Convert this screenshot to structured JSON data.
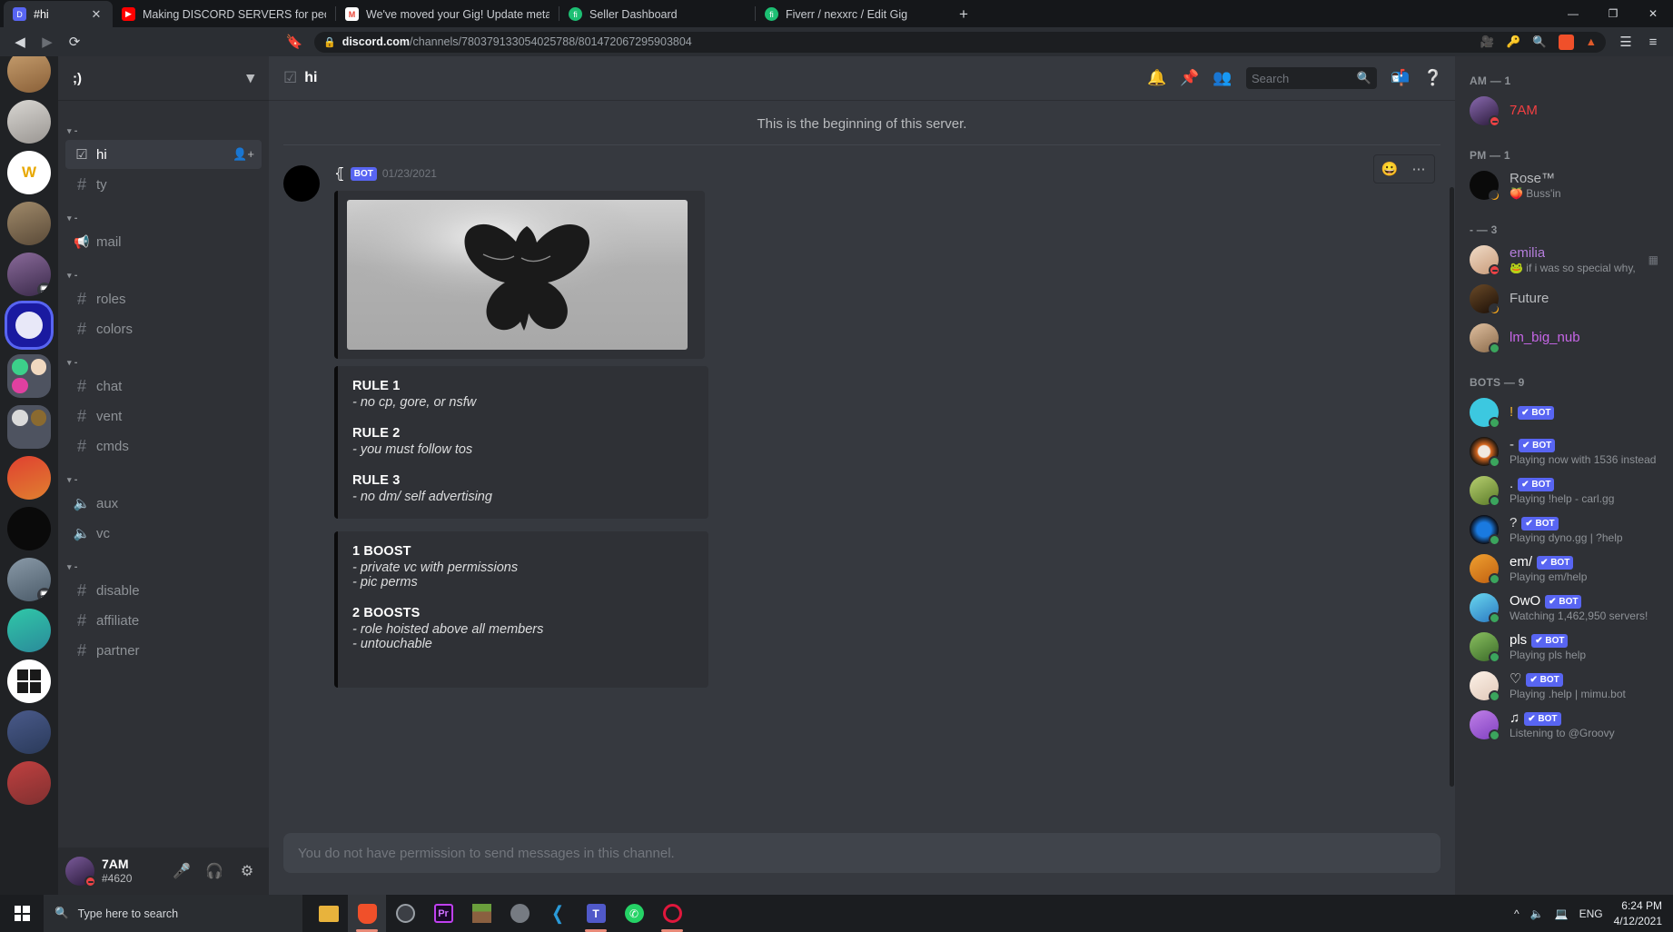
{
  "browser": {
    "tabs": [
      {
        "title": "#hi",
        "favicon": "discord-icon",
        "active": true
      },
      {
        "title": "Making DISCORD SERVERS for people",
        "favicon": "youtube-icon",
        "active": false
      },
      {
        "title": "We've moved your Gig! Update metad",
        "favicon": "gmail-icon",
        "active": false
      },
      {
        "title": "Seller Dashboard",
        "favicon": "fiverr-icon",
        "active": false
      },
      {
        "title": "Fiverr / nexxrc / Edit Gig",
        "favicon": "fiverr-icon",
        "active": false
      }
    ],
    "new_tab_label": "+",
    "window_controls": {
      "minimize": "—",
      "maximize": "❐",
      "close": "✕"
    },
    "url_host": "discord.com",
    "url_path": "/channels/780379133054025788/801472067295903804",
    "close_tab_label": "✕"
  },
  "guild_header": {
    "name": ";)",
    "chevron": "⌄"
  },
  "channels": {
    "categories": [
      {
        "name": "-",
        "items": [
          {
            "name": "hi",
            "type": "rules",
            "active": true,
            "invite": true
          },
          {
            "name": "ty",
            "type": "text",
            "active": false
          }
        ]
      },
      {
        "name": "-",
        "items": [
          {
            "name": "mail",
            "type": "announcement",
            "active": false
          }
        ]
      },
      {
        "name": "-",
        "items": [
          {
            "name": "roles",
            "type": "text",
            "active": false
          },
          {
            "name": "colors",
            "type": "text",
            "active": false
          }
        ]
      },
      {
        "name": "-",
        "items": [
          {
            "name": "chat",
            "type": "text",
            "active": false
          },
          {
            "name": "vent",
            "type": "text",
            "active": false
          },
          {
            "name": "cmds",
            "type": "text",
            "active": false
          }
        ]
      },
      {
        "name": "-",
        "items": [
          {
            "name": "aux",
            "type": "voice",
            "active": false
          },
          {
            "name": "vc",
            "type": "voice",
            "active": false
          }
        ]
      },
      {
        "name": "-",
        "items": [
          {
            "name": "disable",
            "type": "text",
            "active": false
          },
          {
            "name": "affiliate",
            "type": "text",
            "active": false
          },
          {
            "name": "partner",
            "type": "text",
            "active": false
          }
        ]
      }
    ]
  },
  "user_panel": {
    "name": "7AM",
    "tag": "#4620",
    "status": "dnd"
  },
  "channel_header": {
    "title": "hi",
    "icon": "rules-channel-icon"
  },
  "header_actions": {
    "notification": "bell-icon",
    "pinned": "pin-icon",
    "members": "members-icon",
    "inbox": "inbox-icon",
    "help": "help-icon"
  },
  "search": {
    "placeholder": "Search",
    "value": ""
  },
  "conversation": {
    "beginning_text": "This is the beginning of this server.",
    "message": {
      "author": "⦃",
      "bot_badge": "BOT",
      "timestamp": "01/23/2021",
      "hover_actions": {
        "react": "add-reaction-icon",
        "more": "more-icon"
      }
    },
    "embeds": [
      {
        "type": "image",
        "alt": "butterfly"
      },
      {
        "type": "text",
        "entries": [
          {
            "title": "RULE 1",
            "body": "- no cp, gore, or nsfw"
          },
          {
            "title": "RULE 2",
            "body": "- you must follow tos"
          },
          {
            "title": "RULE 3",
            "body": "- no dm/ self advertising"
          }
        ]
      },
      {
        "type": "text",
        "entries": [
          {
            "title": "1 BOOST",
            "body": "- private vc with permissions\n- pic perms"
          },
          {
            "title": "2 BOOSTS",
            "body": "- role hoisted above all members\n- untouchable"
          }
        ]
      }
    ]
  },
  "composer": {
    "placeholder": "You do not have permission to send messages in this channel."
  },
  "member_list": {
    "groups": [
      {
        "label": "AM — 1",
        "members": [
          {
            "name": "7AM",
            "color": "#f23f42",
            "status": "dnd",
            "activity": "",
            "bot": false,
            "avatar": "#3a2b52"
          }
        ]
      },
      {
        "label": "PM — 1",
        "members": [
          {
            "name": "Rose™",
            "color": "#8e9297",
            "status": "idle",
            "activity": "🍑 Buss'in",
            "bot": false,
            "avatar": "#0a0a0a"
          }
        ]
      },
      {
        "label": "- — 3",
        "members": [
          {
            "name": "emilia",
            "color": "#b57edc",
            "status": "dnd",
            "activity": "🐸 if i was so special why, ...",
            "bot": false,
            "avatar": "#e8cfc0",
            "tail": "activity-icon"
          },
          {
            "name": "Future",
            "color": "#8e9297",
            "status": "idle",
            "activity": "",
            "bot": false,
            "avatar": "#2a1a10"
          },
          {
            "name": "lm_big_nub",
            "color": "#c766e8",
            "status": "online",
            "activity": "",
            "bot": false,
            "avatar": "#c8a88a"
          }
        ]
      },
      {
        "label": "BOTS — 9",
        "members": [
          {
            "name": "!",
            "color": "#f0b232",
            "status": "online",
            "activity": "",
            "bot": true,
            "bot_label": "BOT",
            "avatar": "#3cc8e0"
          },
          {
            "name": "-",
            "color": "#dcddde",
            "status": "online",
            "activity": "Playing now with 1536 instead ...",
            "bot": true,
            "bot_label": "BOT",
            "avatar": "#18140f"
          },
          {
            "name": ".",
            "color": "#dcddde",
            "status": "online",
            "activity": "Playing !help - carl.gg",
            "bot": true,
            "bot_label": "BOT",
            "avatar": "#7aa83c"
          },
          {
            "name": "?",
            "color": "#dcddde",
            "status": "online",
            "activity": "Playing dyno.gg | ?help",
            "bot": true,
            "bot_label": "BOT",
            "avatar": "#0c0c12"
          },
          {
            "name": "em/",
            "color": "#ffffff",
            "status": "online",
            "activity": "Playing em/help",
            "bot": true,
            "bot_label": "BOT",
            "avatar": "#e08a2a"
          },
          {
            "name": "OwO",
            "color": "#ffffff",
            "status": "online",
            "activity": "Watching 1,462,950 servers!",
            "bot": true,
            "bot_label": "BOT",
            "avatar": "#46c8e8"
          },
          {
            "name": "pls",
            "color": "#ffffff",
            "status": "online",
            "activity": "Playing pls help",
            "bot": true,
            "bot_label": "BOT",
            "avatar": "#5a9a40"
          },
          {
            "name": "♡",
            "color": "#ffffff",
            "status": "online",
            "activity": "Playing .help | mimu.bot",
            "bot": true,
            "bot_label": "BOT",
            "avatar": "#f0e4d8"
          },
          {
            "name": "♫",
            "color": "#ffffff",
            "status": "online",
            "activity": "Listening to @Groovy",
            "bot": true,
            "bot_label": "BOT",
            "avatar": "#9a6ad0"
          }
        ]
      }
    ]
  },
  "taskbar": {
    "search_placeholder": "Type here to search",
    "apps": [
      {
        "name": "file-explorer",
        "color": "#e8b33c"
      },
      {
        "name": "brave-browser",
        "color": "#f0502a",
        "active": true
      },
      {
        "name": "obs-studio",
        "color": "#3c3f45"
      },
      {
        "name": "premiere-pro",
        "color": "#c040f0"
      },
      {
        "name": "minecraft",
        "color": "#6a9e3c"
      },
      {
        "name": "unknown-app",
        "color": "#767b82"
      },
      {
        "name": "vs-code",
        "color": "#2a9ad8"
      },
      {
        "name": "microsoft-teams",
        "color": "#5059c9"
      },
      {
        "name": "whatsapp",
        "color": "#25d366"
      },
      {
        "name": "opera-gx",
        "color": "#e0173c"
      }
    ],
    "language": "ENG",
    "time": "6:24 PM",
    "date": "4/12/2021"
  }
}
